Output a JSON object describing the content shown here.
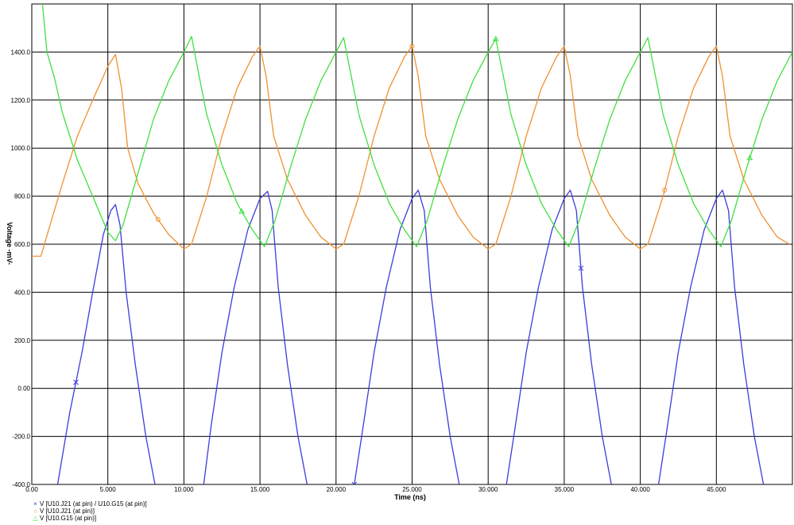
{
  "chart_data": {
    "type": "line",
    "xlabel": "Time  (ns)",
    "ylabel": "Voltage  -mV-",
    "xlim": [
      0,
      50
    ],
    "ylim": [
      -400,
      1600
    ],
    "grid": true,
    "legend_position": "bottom-left",
    "x_ticks": [
      "0.00",
      "5.000",
      "10.000",
      "15.000",
      "20.000",
      "25.000",
      "30.000",
      "35.000",
      "40.000",
      "45.000"
    ],
    "x_tick_values": [
      0,
      5,
      10,
      15,
      20,
      25,
      30,
      35,
      40,
      45
    ],
    "y_ticks": [
      "-400.0",
      "-200.0",
      "0.00",
      "200.0",
      "400.0",
      "600.0",
      "800.0",
      "1000.0",
      "1200.0",
      "1400.0"
    ],
    "y_tick_values": [
      -400,
      -200,
      0,
      200,
      400,
      600,
      800,
      1000,
      1200,
      1400
    ],
    "series": [
      {
        "name": "V [U10.J21 (at pin) / U10.G15 (at pin)]",
        "color": "#3c3cdc",
        "marker": "×",
        "marker_x": [
          2.9,
          21.2,
          36.1
        ],
        "segments": [
          [
            [
              1.7,
              -400
            ],
            [
              2.5,
              -100
            ],
            [
              3.3,
              150
            ],
            [
              4.0,
              400
            ],
            [
              4.7,
              640
            ],
            [
              5.2,
              740
            ],
            [
              5.5,
              765
            ],
            [
              5.8,
              680
            ],
            [
              6.2,
              400
            ],
            [
              6.8,
              100
            ],
            [
              7.5,
              -200
            ],
            [
              8.1,
              -400
            ]
          ],
          [
            [
              11.3,
              -400
            ],
            [
              11.8,
              -150
            ],
            [
              12.5,
              150
            ],
            [
              13.3,
              420
            ],
            [
              14.2,
              660
            ],
            [
              15.0,
              790
            ],
            [
              15.5,
              820
            ],
            [
              15.8,
              740
            ],
            [
              16.2,
              420
            ],
            [
              16.8,
              100
            ],
            [
              17.5,
              -200
            ],
            [
              18.1,
              -400
            ]
          ],
          [
            [
              21.2,
              -400
            ],
            [
              21.8,
              -150
            ],
            [
              22.5,
              150
            ],
            [
              23.3,
              420
            ],
            [
              24.2,
              660
            ],
            [
              25.0,
              790
            ],
            [
              25.4,
              825
            ],
            [
              25.8,
              740
            ],
            [
              26.2,
              420
            ],
            [
              26.8,
              100
            ],
            [
              27.5,
              -200
            ],
            [
              28.1,
              -400
            ]
          ],
          [
            [
              31.2,
              -400
            ],
            [
              31.8,
              -150
            ],
            [
              32.5,
              150
            ],
            [
              33.3,
              420
            ],
            [
              34.2,
              660
            ],
            [
              35.0,
              790
            ],
            [
              35.4,
              825
            ],
            [
              35.8,
              740
            ],
            [
              36.2,
              420
            ],
            [
              36.8,
              100
            ],
            [
              37.5,
              -200
            ],
            [
              38.1,
              -400
            ]
          ],
          [
            [
              41.2,
              -400
            ],
            [
              41.8,
              -150
            ],
            [
              42.5,
              150
            ],
            [
              43.3,
              420
            ],
            [
              44.2,
              660
            ],
            [
              45.0,
              790
            ],
            [
              45.4,
              825
            ],
            [
              45.8,
              740
            ],
            [
              46.2,
              420
            ],
            [
              46.8,
              100
            ],
            [
              47.5,
              -200
            ],
            [
              48.1,
              -400
            ]
          ]
        ]
      },
      {
        "name": "V [U10.J21 (at pin)]",
        "color": "#f09030",
        "marker": "○",
        "marker_x": [
          8.3,
          25.0,
          41.6
        ],
        "segments": [
          [
            [
              0.0,
              550
            ],
            [
              0.6,
              550
            ],
            [
              1.2,
              680
            ],
            [
              2.0,
              850
            ],
            [
              3.0,
              1050
            ],
            [
              4.0,
              1200
            ],
            [
              5.0,
              1340
            ],
            [
              5.5,
              1390
            ],
            [
              5.9,
              1250
            ],
            [
              6.3,
              1000
            ],
            [
              7.0,
              850
            ],
            [
              8.0,
              730
            ],
            [
              9.0,
              640
            ],
            [
              10.0,
              580
            ],
            [
              10.5,
              600
            ],
            [
              11.5,
              800
            ],
            [
              12.5,
              1050
            ],
            [
              13.5,
              1250
            ],
            [
              14.5,
              1380
            ],
            [
              15.0,
              1425
            ],
            [
              15.4,
              1300
            ],
            [
              15.9,
              1050
            ],
            [
              16.8,
              870
            ],
            [
              18.0,
              720
            ],
            [
              19.0,
              630
            ],
            [
              20.0,
              580
            ],
            [
              20.5,
              600
            ],
            [
              21.5,
              800
            ],
            [
              22.5,
              1050
            ],
            [
              23.5,
              1250
            ],
            [
              24.5,
              1380
            ],
            [
              25.0,
              1425
            ],
            [
              25.4,
              1300
            ],
            [
              25.9,
              1050
            ],
            [
              26.8,
              870
            ],
            [
              28.0,
              720
            ],
            [
              29.0,
              630
            ],
            [
              30.0,
              580
            ],
            [
              30.5,
              600
            ],
            [
              31.5,
              800
            ],
            [
              32.5,
              1050
            ],
            [
              33.5,
              1250
            ],
            [
              34.5,
              1380
            ],
            [
              35.0,
              1425
            ],
            [
              35.4,
              1300
            ],
            [
              35.9,
              1050
            ],
            [
              36.8,
              870
            ],
            [
              38.0,
              720
            ],
            [
              39.0,
              630
            ],
            [
              40.0,
              580
            ],
            [
              40.5,
              600
            ],
            [
              41.5,
              800
            ],
            [
              42.5,
              1050
            ],
            [
              43.5,
              1250
            ],
            [
              44.5,
              1380
            ],
            [
              45.0,
              1425
            ],
            [
              45.4,
              1300
            ],
            [
              45.9,
              1050
            ],
            [
              46.8,
              870
            ],
            [
              48.0,
              720
            ],
            [
              49.0,
              630
            ],
            [
              49.8,
              600
            ]
          ]
        ]
      },
      {
        "name": "V [U10.G15 (at pin)]",
        "color": "#40e040",
        "marker": "△",
        "marker_x": [
          13.8,
          30.5,
          47.2
        ],
        "segments": [
          [
            [
              0.7,
              1600
            ],
            [
              1.0,
              1400
            ],
            [
              1.5,
              1290
            ],
            [
              2.0,
              1150
            ],
            [
              3.0,
              950
            ],
            [
              4.0,
              800
            ],
            [
              5.0,
              650
            ],
            [
              5.5,
              615
            ],
            [
              6.0,
              680
            ],
            [
              7.0,
              900
            ],
            [
              8.0,
              1120
            ],
            [
              9.0,
              1280
            ],
            [
              10.0,
              1400
            ],
            [
              10.5,
              1465
            ],
            [
              11.0,
              1300
            ],
            [
              11.5,
              1140
            ],
            [
              12.5,
              930
            ],
            [
              13.5,
              770
            ],
            [
              14.5,
              660
            ],
            [
              15.3,
              590
            ],
            [
              16.0,
              700
            ],
            [
              17.0,
              920
            ],
            [
              18.0,
              1120
            ],
            [
              19.0,
              1280
            ],
            [
              20.0,
              1400
            ],
            [
              20.5,
              1460
            ],
            [
              21.0,
              1300
            ],
            [
              21.5,
              1140
            ],
            [
              22.5,
              930
            ],
            [
              23.5,
              770
            ],
            [
              24.5,
              660
            ],
            [
              25.3,
              590
            ],
            [
              26.0,
              700
            ],
            [
              27.0,
              920
            ],
            [
              28.0,
              1120
            ],
            [
              29.0,
              1280
            ],
            [
              30.0,
              1400
            ],
            [
              30.5,
              1455
            ],
            [
              31.0,
              1300
            ],
            [
              31.5,
              1140
            ],
            [
              32.5,
              930
            ],
            [
              33.5,
              770
            ],
            [
              34.5,
              660
            ],
            [
              35.3,
              590
            ],
            [
              36.0,
              700
            ],
            [
              37.0,
              920
            ],
            [
              38.0,
              1120
            ],
            [
              39.0,
              1280
            ],
            [
              40.0,
              1400
            ],
            [
              40.5,
              1460
            ],
            [
              41.0,
              1300
            ],
            [
              41.5,
              1140
            ],
            [
              42.5,
              930
            ],
            [
              43.5,
              770
            ],
            [
              44.5,
              660
            ],
            [
              45.3,
              590
            ],
            [
              46.0,
              700
            ],
            [
              47.0,
              920
            ],
            [
              48.0,
              1120
            ],
            [
              49.0,
              1280
            ],
            [
              50.0,
              1400
            ]
          ]
        ]
      }
    ]
  }
}
